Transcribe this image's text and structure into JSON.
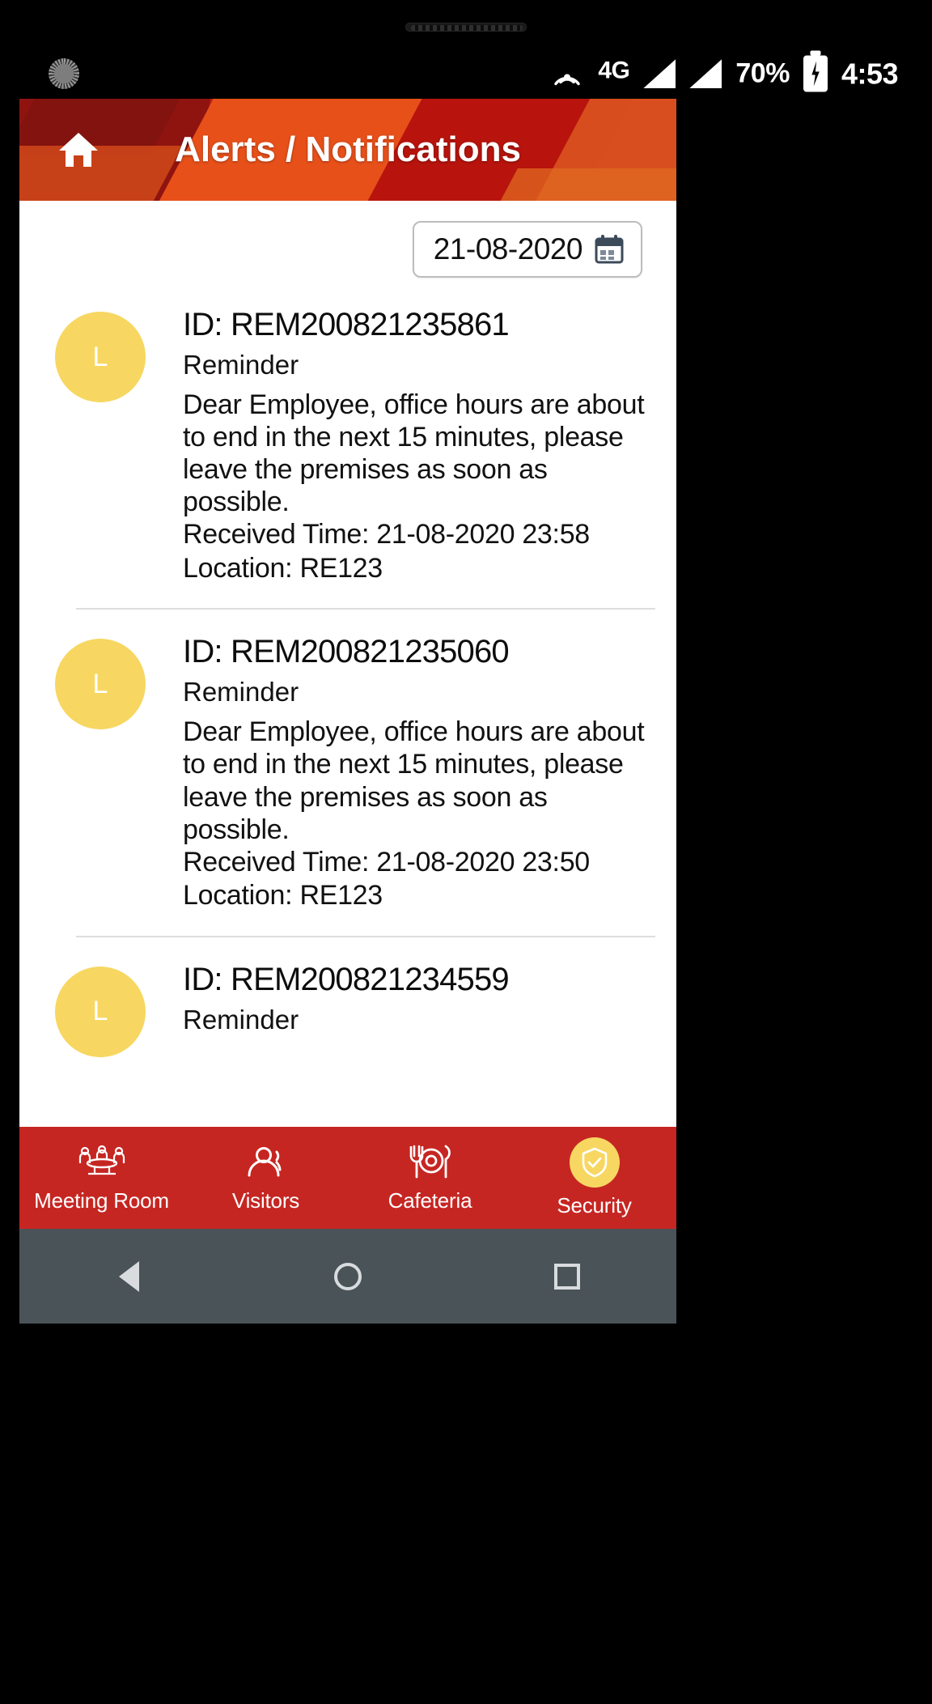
{
  "status_bar": {
    "left_icon": "sunburst-icon",
    "hotspot_icon": "hotspot-icon",
    "network": "4G",
    "signal_icon_1": "signal-bars-icon",
    "signal_icon_2": "signal-bars-icon",
    "battery_percent": "70%",
    "battery_icon": "battery-charging-icon",
    "time": "4:53"
  },
  "app_bar": {
    "home_icon": "home-icon",
    "title": "Alerts / Notifications"
  },
  "date_filter": {
    "value": "21-08-2020",
    "calendar_icon": "calendar-icon"
  },
  "notifications": [
    {
      "avatar_letter": "L",
      "id": "ID: REM200821235861",
      "type": "Reminder",
      "message": "Dear Employee, office hours are about to end in the next 15 minutes, please leave the premises as soon as possible.",
      "received": "Received Time: 21-08-2020 23:58",
      "location": "Location: RE123"
    },
    {
      "avatar_letter": "L",
      "id": "ID: REM200821235060",
      "type": "Reminder",
      "message": "Dear Employee, office hours are about to end in the next 15 minutes, please leave the premises as soon as possible.",
      "received": "Received Time: 21-08-2020 23:50",
      "location": "Location: RE123"
    },
    {
      "avatar_letter": "L",
      "id": "ID: REM200821234559",
      "type": "Reminder",
      "message": "",
      "received": "",
      "location": ""
    }
  ],
  "tab_bar": {
    "items": [
      {
        "label": "Meeting Room",
        "icon": "meeting-room-icon",
        "active": false
      },
      {
        "label": "Visitors",
        "icon": "visitors-icon",
        "active": false
      },
      {
        "label": "Cafeteria",
        "icon": "cafeteria-icon",
        "active": false
      },
      {
        "label": "Security",
        "icon": "security-shield-icon",
        "active": true
      }
    ]
  },
  "nav_bar": {
    "back": "back-triangle-icon",
    "home": "home-circle-icon",
    "recents": "recents-square-icon"
  },
  "colors": {
    "header_red": "#c0180f",
    "header_orange": "#e8501a",
    "tabbar_red": "#c62622",
    "avatar_yellow": "#f7d761",
    "navbar_gray": "#4a5358"
  }
}
